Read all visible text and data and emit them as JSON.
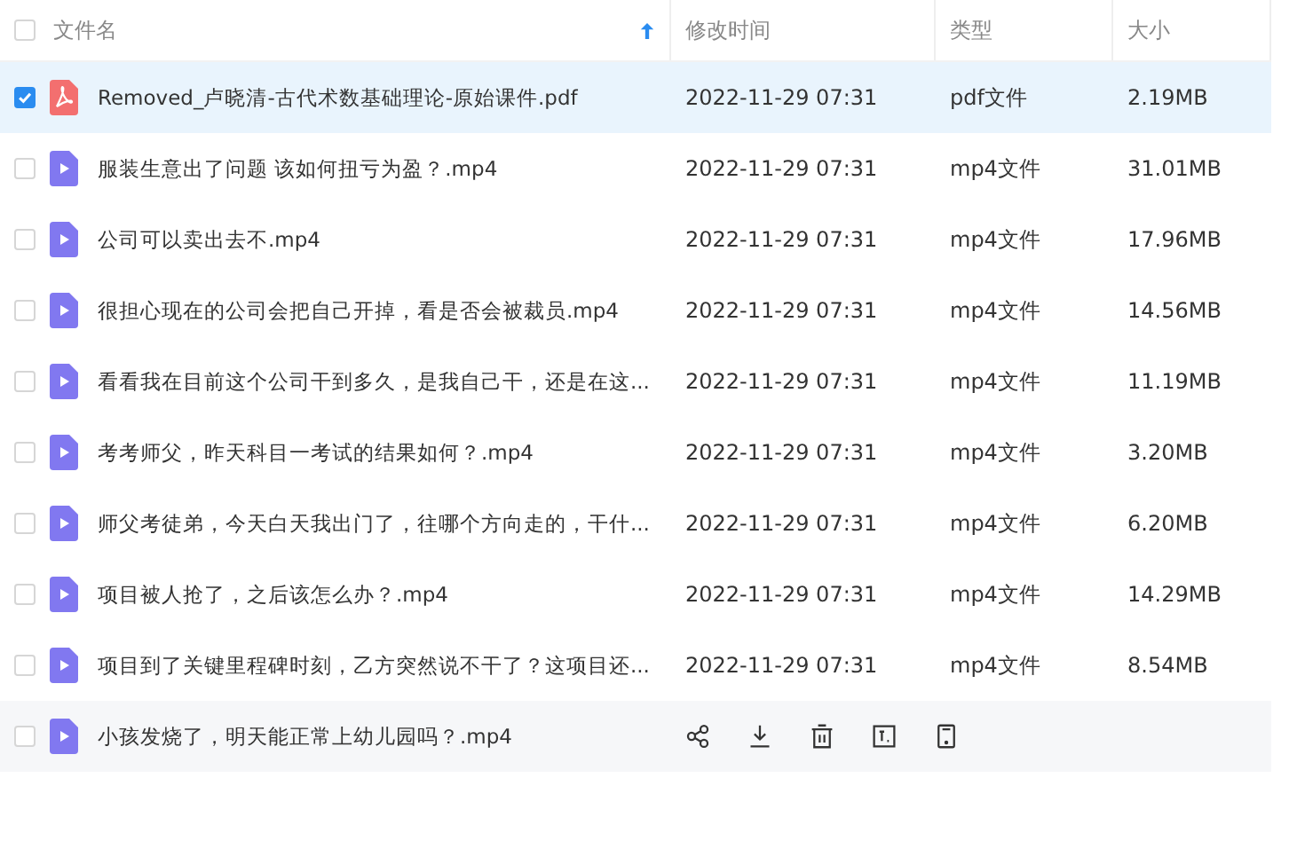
{
  "table": {
    "select_all": {
      "checked": false
    },
    "columns": [
      {
        "label": "文件名",
        "sorted": true
      },
      {
        "label": "修改时间",
        "sorted": false
      },
      {
        "label": "类型",
        "sorted": false
      },
      {
        "label": "大小",
        "sorted": false
      }
    ],
    "rows": [
      {
        "kind": "pdf",
        "name": "Removed_卢晓清-古代术数基础理论-原始课件.pdf",
        "modified": "2022-11-29 07:31",
        "type": "pdf文件",
        "size": "2.19MB",
        "selected": true,
        "hovered": false
      },
      {
        "kind": "video",
        "name": "服装生意出了问题 该如何扭亏为盈？.mp4",
        "modified": "2022-11-29 07:31",
        "type": "mp4文件",
        "size": "31.01MB",
        "selected": false,
        "hovered": false
      },
      {
        "kind": "video",
        "name": "公司可以卖出去不.mp4",
        "modified": "2022-11-29 07:31",
        "type": "mp4文件",
        "size": "17.96MB",
        "selected": false,
        "hovered": false
      },
      {
        "kind": "video",
        "name": "很担心现在的公司会把自己开掉，看是否会被裁员.mp4",
        "modified": "2022-11-29 07:31",
        "type": "mp4文件",
        "size": "14.56MB",
        "selected": false,
        "hovered": false
      },
      {
        "kind": "video",
        "name": "看看我在目前这个公司干到多久，是我自己干，还是在这...",
        "modified": "2022-11-29 07:31",
        "type": "mp4文件",
        "size": "11.19MB",
        "selected": false,
        "hovered": false
      },
      {
        "kind": "video",
        "name": "考考师父，昨天科目一考试的结果如何？.mp4",
        "modified": "2022-11-29 07:31",
        "type": "mp4文件",
        "size": "3.20MB",
        "selected": false,
        "hovered": false
      },
      {
        "kind": "video",
        "name": "师父考徒弟，今天白天我出门了，往哪个方向走的，干什...",
        "modified": "2022-11-29 07:31",
        "type": "mp4文件",
        "size": "6.20MB",
        "selected": false,
        "hovered": false
      },
      {
        "kind": "video",
        "name": "项目被人抢了，之后该怎么办？.mp4",
        "modified": "2022-11-29 07:31",
        "type": "mp4文件",
        "size": "14.29MB",
        "selected": false,
        "hovered": false
      },
      {
        "kind": "video",
        "name": "项目到了关键里程碑时刻，乙方突然说不干了？这项目还...",
        "modified": "2022-11-29 07:31",
        "type": "mp4文件",
        "size": "8.54MB",
        "selected": false,
        "hovered": false
      },
      {
        "kind": "video",
        "name": "小孩发烧了，明天能正常上幼儿园吗？.mp4",
        "selected": false,
        "hovered": true
      }
    ]
  }
}
